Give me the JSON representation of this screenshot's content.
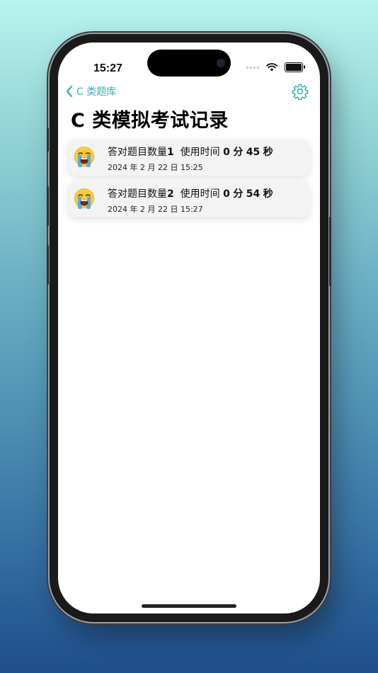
{
  "status_bar": {
    "time": "15:27"
  },
  "nav": {
    "back_label": "C 类题库"
  },
  "page": {
    "title": "C 类模拟考试记录"
  },
  "records": [
    {
      "emoji": "loudly-crying-face",
      "correct_label": "答对题目数量",
      "correct_count": "1",
      "time_label": "使用时间",
      "minutes": "0",
      "minute_unit": "分",
      "seconds": "45",
      "second_unit": "秒",
      "date": "2024 年 2 月 22 日 15:25"
    },
    {
      "emoji": "loudly-crying-face",
      "correct_label": "答对题目数量",
      "correct_count": "2",
      "time_label": "使用时间",
      "minutes": "0",
      "minute_unit": "分",
      "seconds": "54",
      "second_unit": "秒",
      "date": "2024 年 2 月 22 日 15:27"
    }
  ],
  "colors": {
    "accent": "#34b3b8",
    "card_bg": "#f3f3f3"
  }
}
